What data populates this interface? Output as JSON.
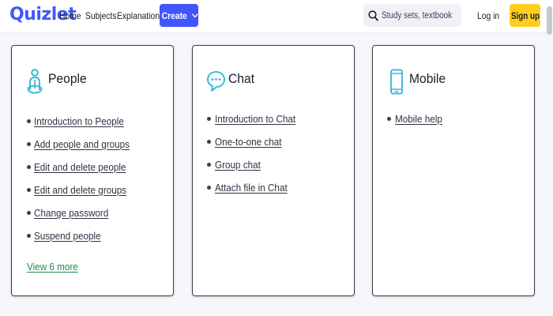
{
  "header": {
    "logo": "Quizlet",
    "nav": [
      "Home",
      "Subjects",
      "Explanations"
    ],
    "create_label": "Create",
    "search_placeholder": "Study sets, textbooks, ...",
    "login_label": "Log in",
    "signup_label": "Sign up"
  },
  "colors": {
    "brand": "#4255ff",
    "signup": "#ffcd1f",
    "icon_accent": "#2fb5d3",
    "view_more": "#1f8a4c"
  },
  "cards": [
    {
      "title": "People",
      "icon": "person-icon",
      "links": [
        "Introduction to People",
        "Add people and groups",
        "Edit and delete people",
        "Edit and delete groups",
        "Change password",
        "Suspend people"
      ],
      "view_more": "View 6 more"
    },
    {
      "title": "Chat",
      "icon": "chat-bubble-icon",
      "links": [
        "Introduction to Chat",
        "One-to-one chat",
        "Group chat",
        "Attach file in Chat"
      ]
    },
    {
      "title": "Mobile",
      "icon": "mobile-phone-icon",
      "links": [
        "Mobile help"
      ]
    }
  ]
}
